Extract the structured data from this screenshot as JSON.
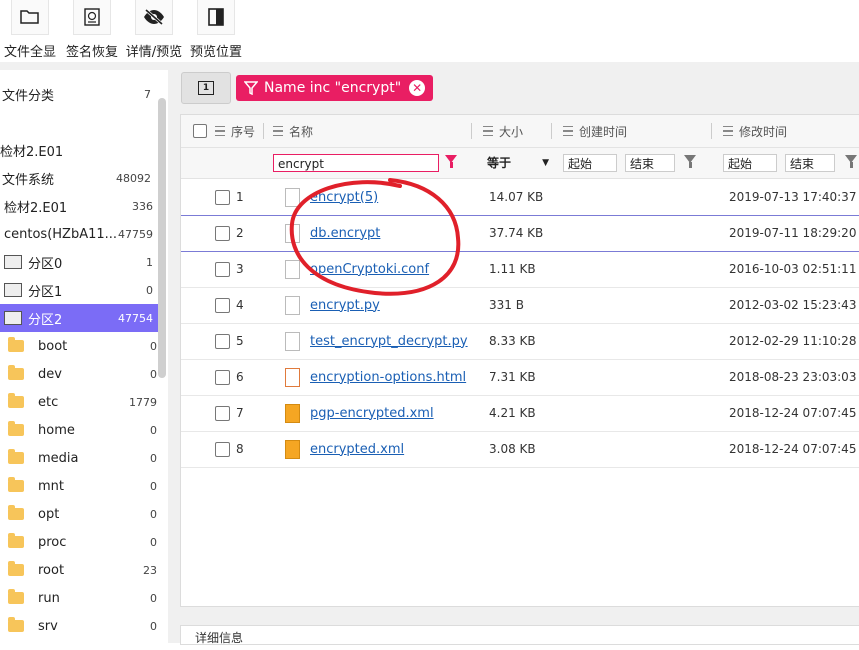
{
  "toolbar": {
    "buttons": [
      {
        "label": "文件全显",
        "icon": "folder-open-icon"
      },
      {
        "label": "签名恢复",
        "icon": "signature-restore-icon"
      },
      {
        "label": "详情/预览",
        "icon": "eye-off-icon"
      },
      {
        "label": "预览位置",
        "icon": "panel-right-icon"
      }
    ]
  },
  "sidebar": {
    "items": [
      {
        "label": "文件分类",
        "count": "7"
      },
      {
        "label": "检材2.E01",
        "count": ""
      },
      {
        "label": "文件系统",
        "count": "48092"
      },
      {
        "label": "检材2.E01",
        "count": "336"
      },
      {
        "label": "centos(HZbA11...",
        "count": "47759"
      },
      {
        "label": "分区0",
        "count": "1"
      },
      {
        "label": "分区1",
        "count": "0"
      },
      {
        "label": "分区2",
        "count": "47754"
      },
      {
        "label": "boot",
        "count": "0"
      },
      {
        "label": "dev",
        "count": "0"
      },
      {
        "label": "etc",
        "count": "1779"
      },
      {
        "label": "home",
        "count": "0"
      },
      {
        "label": "media",
        "count": "0"
      },
      {
        "label": "mnt",
        "count": "0"
      },
      {
        "label": "opt",
        "count": "0"
      },
      {
        "label": "proc",
        "count": "0"
      },
      {
        "label": "root",
        "count": "23"
      },
      {
        "label": "run",
        "count": "0"
      },
      {
        "label": "srv",
        "count": "0"
      }
    ]
  },
  "filter": {
    "page_label": "1",
    "chip_label": "Name inc \"encrypt\"",
    "chip_close": "✕"
  },
  "grid": {
    "headers": {
      "index": "序号",
      "name": "名称",
      "size": "大小",
      "created": "创建时间",
      "modified": "修改时间"
    },
    "filters": {
      "name_value": "encrypt",
      "size_op": "等于",
      "created_start": "起始",
      "created_end": "结束",
      "modified_start": "起始",
      "modified_end": "结束"
    },
    "rows": [
      {
        "index": "1",
        "name": "encrypt(5)",
        "size": "14.07 KB",
        "created": "2019-07-13 17:40:37"
      },
      {
        "index": "2",
        "name": "db.encrypt",
        "size": "37.74 KB",
        "created": "2019-07-11 18:29:20"
      },
      {
        "index": "3",
        "name": "openCryptoki.conf",
        "size": "1.11 KB",
        "created": "2016-10-03 02:51:11"
      },
      {
        "index": "4",
        "name": "encrypt.py",
        "size": "331 B",
        "created": "2012-03-02 15:23:43"
      },
      {
        "index": "5",
        "name": "test_encrypt_decrypt.py",
        "size": "8.33 KB",
        "created": "2012-02-29 11:10:28"
      },
      {
        "index": "6",
        "name": "encryption-options.html",
        "size": "7.31 KB",
        "created": "2018-08-23 23:03:03"
      },
      {
        "index": "7",
        "name": "pgp-encrypted.xml",
        "size": "4.21 KB",
        "created": "2018-12-24 07:07:45"
      },
      {
        "index": "8",
        "name": "encrypted.xml",
        "size": "3.08 KB",
        "created": "2018-12-24 07:07:45"
      }
    ]
  },
  "bottom_panel": {
    "title": "详细信息"
  },
  "colors": {
    "accent": "#7b6cf6",
    "chip": "#e91e63",
    "annotation": "#e0202a"
  }
}
